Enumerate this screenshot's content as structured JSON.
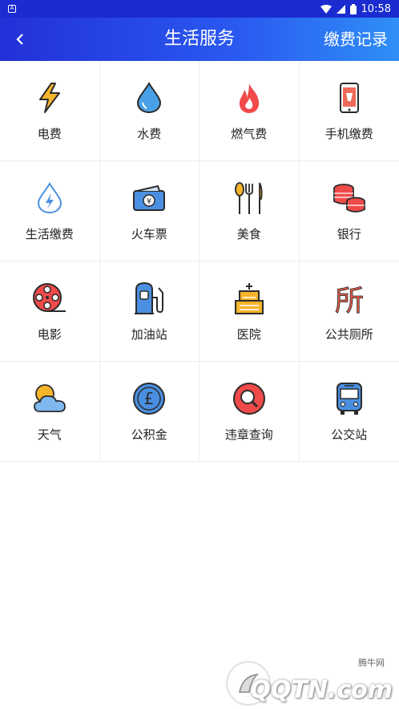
{
  "status_bar": {
    "time": "10:58"
  },
  "header": {
    "title": "生活服务",
    "record_label": "缴费记录"
  },
  "services": [
    {
      "label": "电费",
      "icon": "lightning-icon"
    },
    {
      "label": "水费",
      "icon": "water-drop-icon"
    },
    {
      "label": "燃气费",
      "icon": "flame-icon"
    },
    {
      "label": "手机缴费",
      "icon": "mobile-phone-icon"
    },
    {
      "label": "生活缴费",
      "icon": "utility-drop-icon"
    },
    {
      "label": "火车票",
      "icon": "train-ticket-icon",
      "icon_text": "¥"
    },
    {
      "label": "美食",
      "icon": "cutlery-icon"
    },
    {
      "label": "银行",
      "icon": "coins-icon"
    },
    {
      "label": "电影",
      "icon": "film-reel-icon"
    },
    {
      "label": "加油站",
      "icon": "fuel-pump-icon"
    },
    {
      "label": "医院",
      "icon": "hospital-icon"
    },
    {
      "label": "公共厕所",
      "icon": "toilet-icon",
      "icon_text": "所"
    },
    {
      "label": "天气",
      "icon": "weather-icon"
    },
    {
      "label": "公积金",
      "icon": "pound-coin-icon",
      "icon_text": "£"
    },
    {
      "label": "违章查询",
      "icon": "search-violation-icon"
    },
    {
      "label": "公交站",
      "icon": "bus-icon"
    }
  ],
  "watermark": {
    "small_text": "腾牛网",
    "logo_text": "QQTN.com"
  }
}
